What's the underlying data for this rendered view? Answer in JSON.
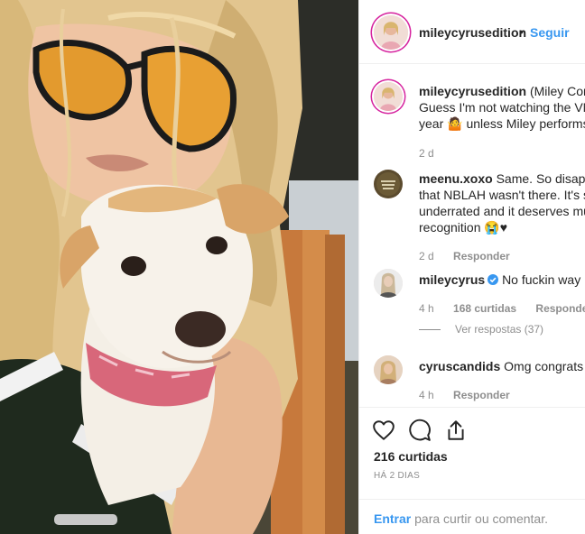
{
  "header": {
    "username": "mileycyrusedition",
    "separator": "•",
    "follow_label": "Seguir"
  },
  "comments": [
    {
      "username": "mileycyrusedition",
      "lines": [
        "(Miley Com",
        "Guess I'm not watching the VM",
        "year 🤷 unless Miley performs"
      ],
      "time": "2 d",
      "avatar": "miley-edition-avatar"
    },
    {
      "username": "meenu.xoxo",
      "lines": [
        "Same. So disappo",
        "that NBLAH wasn't there. It's s",
        "underrated and it deserves mu",
        "recognition 😭♥"
      ],
      "time": "2 d",
      "reply_label": "Responder",
      "avatar": "meenu-avatar"
    },
    {
      "username": "mileycyrus",
      "verified": true,
      "lines": [
        "No fuckin way"
      ],
      "time": "4 h",
      "likes": "168 curtidas",
      "reply_label": "Responder",
      "view_replies": "Ver respostas (37)",
      "avatar": "mileycyrus-avatar"
    },
    {
      "username": "cyruscandids",
      "lines": [
        "Omg congrats"
      ],
      "time": "4 h",
      "reply_label": "Responder",
      "avatar": "cyruscandids-avatar"
    }
  ],
  "actions": {
    "icons": [
      "heart-icon",
      "comment-icon",
      "share-icon"
    ],
    "likes": "216 curtidas",
    "date": "HÁ 2 DIAS"
  },
  "login": {
    "enter_label": "Entrar",
    "rest": "para curtir ou comentar."
  },
  "colors": {
    "link_blue": "#3897f0",
    "muted": "#8e8e8e",
    "border": "#efefef",
    "story_ring": "#d6249f"
  }
}
